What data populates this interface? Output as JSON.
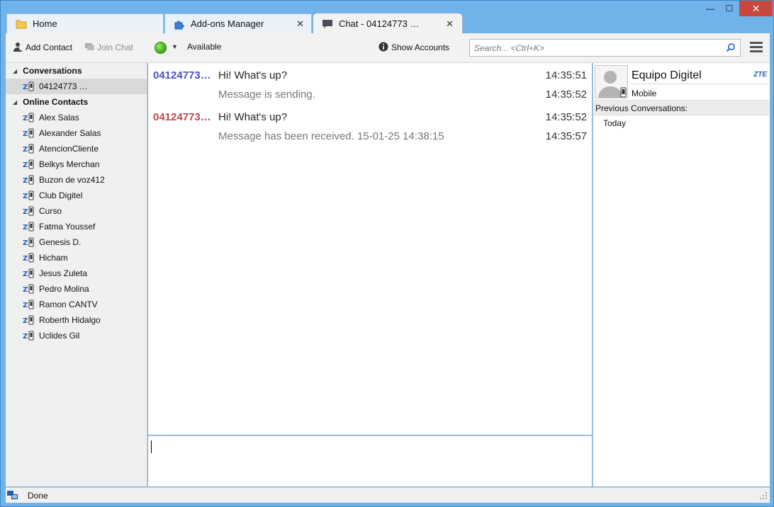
{
  "tabs": [
    {
      "label": "Home",
      "icon": "folder-icon"
    },
    {
      "label": "Add-ons Manager",
      "icon": "puzzle-icon"
    },
    {
      "label": "Chat - 04124773 …",
      "icon": "chat-bubble-icon"
    }
  ],
  "window_controls": {
    "minimize": "—",
    "maximize": "☐",
    "close": "✕"
  },
  "toolbar": {
    "add_contact": "Add Contact",
    "join_chat": "Join Chat",
    "status_label": "Available",
    "status_color": "#3aa818",
    "show_accounts": "Show Accounts",
    "search_placeholder": "Search... <Ctrl+K>"
  },
  "sidebar": {
    "conversations_header": "Conversations",
    "conversations": [
      "04124773 …"
    ],
    "online_header": "Online Contacts",
    "contacts": [
      "Alex Salas",
      "Alexander Salas",
      "AtencionCliente",
      "Belkys Merchan",
      "Buzon de voz412",
      "Club Digitel",
      "Curso",
      "Fatma Youssef",
      "Genesis D.",
      "Hicham",
      "Jesus Zuleta",
      "Pedro Molina",
      "Ramon CANTV",
      "Roberth Hidalgo",
      "Uclides Gil"
    ]
  },
  "messages": [
    {
      "sender": "04124773…",
      "sender_color": "#4b4fc4",
      "text": "Hi! What's up?",
      "time": "14:35:51"
    },
    {
      "sender": "",
      "sender_color": "#4b4fc4",
      "text": "Message is sending.",
      "time": "14:35:52",
      "meta": true
    },
    {
      "sender": "04124773…",
      "sender_color": "#c4464b",
      "text": "Hi! What's up?",
      "time": "14:35:52"
    },
    {
      "sender": "",
      "sender_color": "#c4464b",
      "text": "Message has been received. 15-01-25 14:38:15",
      "time": "14:35:57",
      "meta": true
    }
  ],
  "contact_panel": {
    "name": "Equipo Digitel",
    "protocol": "ZTE",
    "status": "Mobile",
    "previous_header": "Previous Conversations:",
    "previous_items": [
      "Today"
    ]
  },
  "statusbar": {
    "text": "Done"
  }
}
